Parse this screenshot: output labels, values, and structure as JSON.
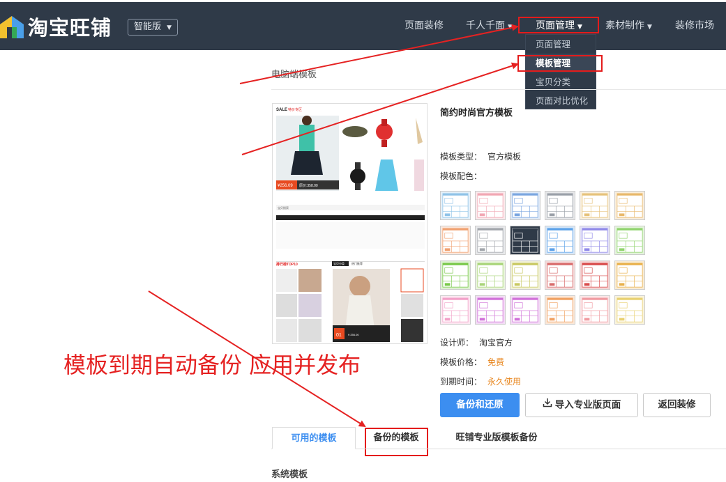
{
  "header": {
    "logo_text": "淘宝旺铺",
    "edition_label": "智能版",
    "nav": [
      {
        "label": "页面装修",
        "caret": false
      },
      {
        "label": "千人千面",
        "caret": true
      },
      {
        "label": "页面管理",
        "caret": true
      },
      {
        "label": "素材制作",
        "caret": true
      },
      {
        "label": "装修市场",
        "caret": false
      }
    ],
    "dropdown": [
      "页面管理",
      "模板管理",
      "宝贝分类",
      "页面对比优化"
    ]
  },
  "page": {
    "section_title": "电脑端模板",
    "template": {
      "name": "简约时尚官方模板",
      "type_label": "模板类型：",
      "type_value": "官方模板",
      "color_label": "模板配色：",
      "designer_label": "设计师：",
      "designer_value": "淘宝官方",
      "price_label": "模板价格：",
      "price_value": "免费",
      "expire_label": "到期时间：",
      "expire_value": "永久使用"
    },
    "swatches": [
      "#8fc3e8",
      "#f1a7b3",
      "#7aa6e0",
      "#9aa0a8",
      "#e6c27a",
      "#e8b86a",
      "#f0a070",
      "#a0a4aa",
      "#2f3a48",
      "#5aa0e8",
      "#8f88e8",
      "#8fd36c",
      "#78c848",
      "#a8d478",
      "#c8c860",
      "#d86a6a",
      "#d84a4a",
      "#e8b04a",
      "#f2a0c8",
      "#d070d8",
      "#d070d8",
      "#f0a060",
      "#f09aa0",
      "#e8d070"
    ],
    "buttons": {
      "backup": "备份和还原",
      "import": "导入专业版页面",
      "back": "返回装修"
    },
    "tabs": [
      "可用的模板",
      "备份的模板",
      "旺铺专业版模板备份"
    ],
    "sys_title": "系统模板"
  },
  "preview": {
    "sale_banner": "SALE",
    "sale_sub": "特价专区",
    "price_main": "¥256.09",
    "price_orig": "原价:358.00",
    "search_label": "宝贝搜索",
    "rank_title": "排行榜TOP10",
    "rank_badge": "01",
    "rank_price": "¥ 256.00",
    "tab_a": "宝贝分类",
    "tab_b": "热门推荐"
  },
  "annotation": {
    "text": "模板到期自动备份  应用并发布"
  },
  "colors": {
    "topbar": "#2f3a48",
    "accent": "#3c8ef0",
    "annotation_red": "#e52222",
    "price_orange": "#e8851c"
  }
}
